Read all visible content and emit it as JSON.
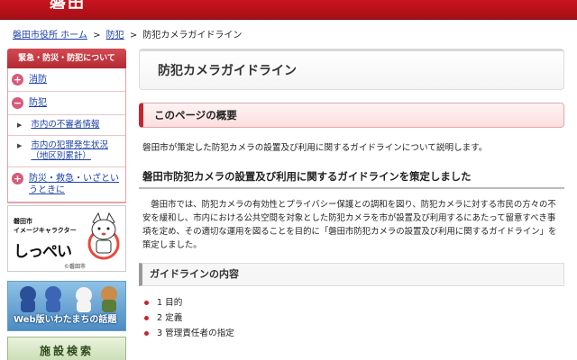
{
  "header": {
    "logo_fragment": "磐田"
  },
  "breadcrumb": {
    "home": "磐田市役所 ホーム",
    "section": "防犯",
    "current": "防犯カメラガイドライン",
    "separator": ">"
  },
  "sidebar": {
    "heading": "緊急・防災・防犯について",
    "items": [
      {
        "label": "消防",
        "toggle": "+"
      },
      {
        "label": "防犯",
        "toggle": "−"
      }
    ],
    "subitems": [
      {
        "label": "市内の不審者情報"
      },
      {
        "label": "市内の犯罪発生状況（地区別累計）"
      }
    ],
    "last_item": {
      "label": "防災・救急・いざというときに",
      "toggle": "+"
    }
  },
  "banners": {
    "mascot": {
      "line1": "磐田市",
      "line2": "イメージキャラクター",
      "name": "しっぺい",
      "copyright": "©磐田市"
    },
    "web": {
      "label": "Web版いわたまちの話題"
    },
    "facility": {
      "label": "施設検索"
    }
  },
  "main": {
    "title": "防犯カメラガイドライン",
    "overview_heading": "このページの概要",
    "overview_text": "磐田市が策定した防犯カメラの設置及び利用に関するガイドラインについて説明します。",
    "section_heading": "磐田市防犯カメラの設置及び利用に関するガイドラインを策定しました",
    "section_body": "磐田市では、防犯カメラの有効性とプライバシー保護との調和を図り、防犯カメラに対する市民の方々の不安を緩和し、市内における公共空間を対象とした防犯カメラを市が設置及び利用するにあたって留意すべき事項を定め、その適切な運用を図ることを目的に「磐田市防犯カメラの設置及び利用に関するガイドライン」を策定しました。",
    "guide_heading": "ガイドラインの内容",
    "toc": [
      {
        "label": "1 目的"
      },
      {
        "label": "2 定義"
      },
      {
        "label": "3 管理責任者の指定"
      }
    ]
  },
  "colors": {
    "brand_red": "#c8141e",
    "link_blue": "#1a3fa8",
    "toggle_pink": "#d75a7a"
  }
}
